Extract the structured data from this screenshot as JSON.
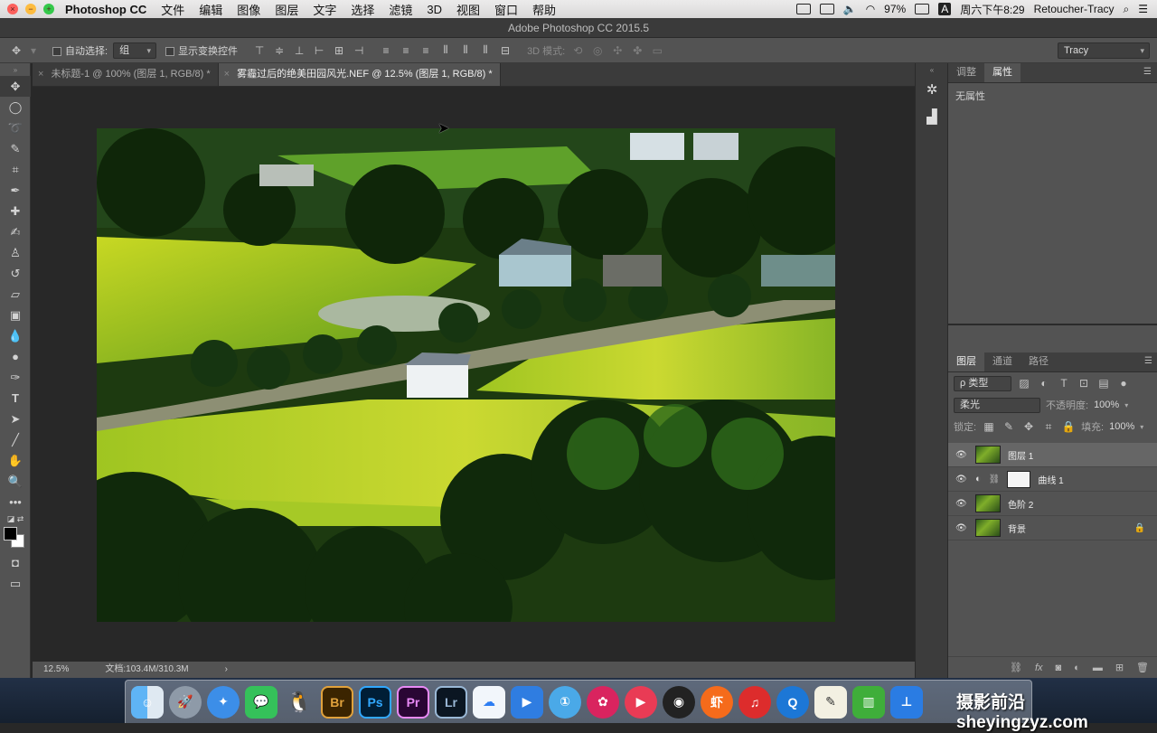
{
  "menubar": {
    "app_name": "Photoshop CC",
    "items": [
      "文件",
      "编辑",
      "图像",
      "图层",
      "文字",
      "选择",
      "滤镜",
      "3D",
      "视图",
      "窗口",
      "帮助"
    ],
    "battery": "97%",
    "clock": "周六下午8:29",
    "user": "Retoucher-Tracy",
    "input_method": "A"
  },
  "window": {
    "title": "Adobe Photoshop CC 2015.5"
  },
  "options": {
    "auto_select_label": "自动选择:",
    "auto_select_value": "组",
    "show_transform_label": "显示变换控件",
    "mode3d_label": "3D 模式:",
    "workspace": "Tracy"
  },
  "tabs": [
    {
      "label": "未标题-1 @ 100% (图层 1, RGB/8) *"
    },
    {
      "label": "雾霾过后的绝美田园风光.NEF @ 12.5% (图层 1, RGB/8) *"
    }
  ],
  "status": {
    "zoom": "12.5%",
    "doc": "文档:103.4M/310.3M",
    "arrow": "›"
  },
  "properties_panel": {
    "tabs": [
      "调整",
      "属性"
    ],
    "empty_text": "无属性"
  },
  "layers_panel": {
    "tabs": [
      "图层",
      "通道",
      "路径"
    ],
    "filter_label": "ρ 类型",
    "blend_mode": "柔光",
    "opacity_label": "不透明度:",
    "opacity_value": "100%",
    "lock_label": "锁定:",
    "fill_label": "填充:",
    "fill_value": "100%",
    "layers": [
      {
        "name": "图层 1",
        "selected": true
      },
      {
        "name": "曲线 1",
        "selected": false
      },
      {
        "name": "色阶 2",
        "selected": false
      },
      {
        "name": "背景",
        "selected": false
      }
    ]
  },
  "dock": {
    "apps": [
      "finder",
      "launchpad",
      "safari",
      "wechat",
      "qq",
      "Br",
      "Ps",
      "Pr",
      "Lr",
      "baidu-cloud",
      "app-store",
      "pin",
      "davinci",
      "music",
      "obs",
      "xiami",
      "netease-music",
      "q-browser",
      "textedit",
      "numbers",
      "keynote"
    ]
  },
  "watermark": "摄影前沿 sheyingzyz.com"
}
